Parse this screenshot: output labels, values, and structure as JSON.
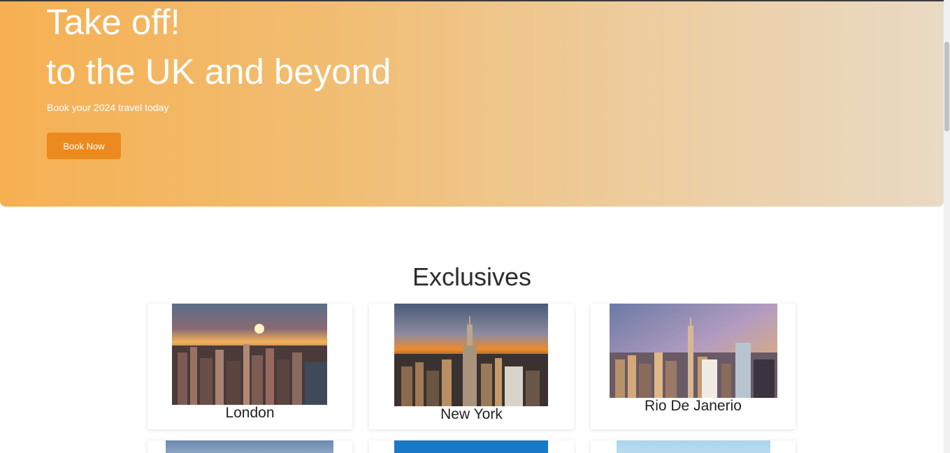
{
  "hero": {
    "title_line1": "Take off!",
    "title_line2": "to the UK and beyond",
    "subtitle": "Book your 2024 travel today",
    "cta_label": "Book Now"
  },
  "exclusives": {
    "title": "Exclusives",
    "cards": [
      {
        "city": "London"
      },
      {
        "city": "New York"
      },
      {
        "city": "Rio De Janerio"
      }
    ]
  },
  "colors": {
    "hero_start": "#f6b052",
    "hero_end": "#e9dac4",
    "cta_background": "#ec8a1e"
  }
}
